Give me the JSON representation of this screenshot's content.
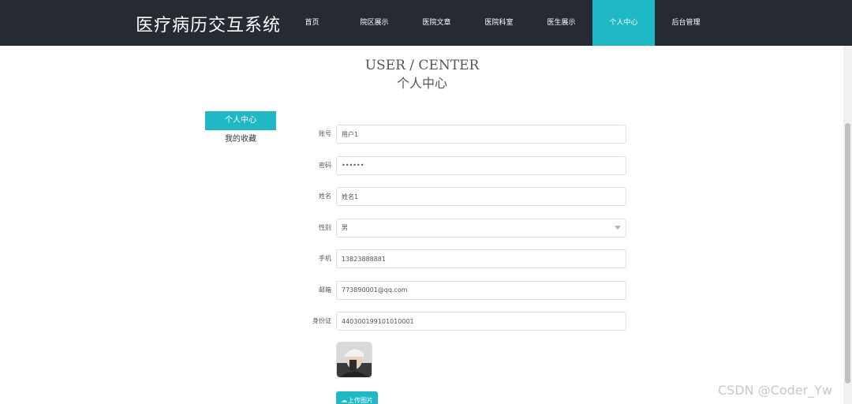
{
  "header": {
    "brand": "医疗病历交互系统",
    "nav": [
      {
        "label": "首页"
      },
      {
        "label": "院区展示"
      },
      {
        "label": "医院文章"
      },
      {
        "label": "医院科室"
      },
      {
        "label": "医生展示"
      },
      {
        "label": "个人中心",
        "active": true
      },
      {
        "label": "后台管理"
      }
    ]
  },
  "title": {
    "en": "USER / CENTER",
    "cn": "个人中心"
  },
  "side_menu": [
    {
      "label": "个人中心",
      "active": true
    },
    {
      "label": "我的收藏"
    }
  ],
  "form": {
    "account": {
      "label": "账号",
      "value": "用户1"
    },
    "password": {
      "label": "密码",
      "value": "••••••"
    },
    "name": {
      "label": "姓名",
      "value": "姓名1"
    },
    "gender": {
      "label": "性别",
      "value": "男"
    },
    "phone": {
      "label": "手机",
      "value": "13823888881"
    },
    "email": {
      "label": "邮箱",
      "value": "773890001@qq.com"
    },
    "id_card": {
      "label": "身份证",
      "value": "440300199101010001"
    }
  },
  "upload": {
    "label": "上传图片",
    "icon": "upload-cloud-icon"
  },
  "watermark": "CSDN @Coder_Yw",
  "colors": {
    "nav_bg": "#252a33",
    "accent": "#1fb8c5"
  }
}
